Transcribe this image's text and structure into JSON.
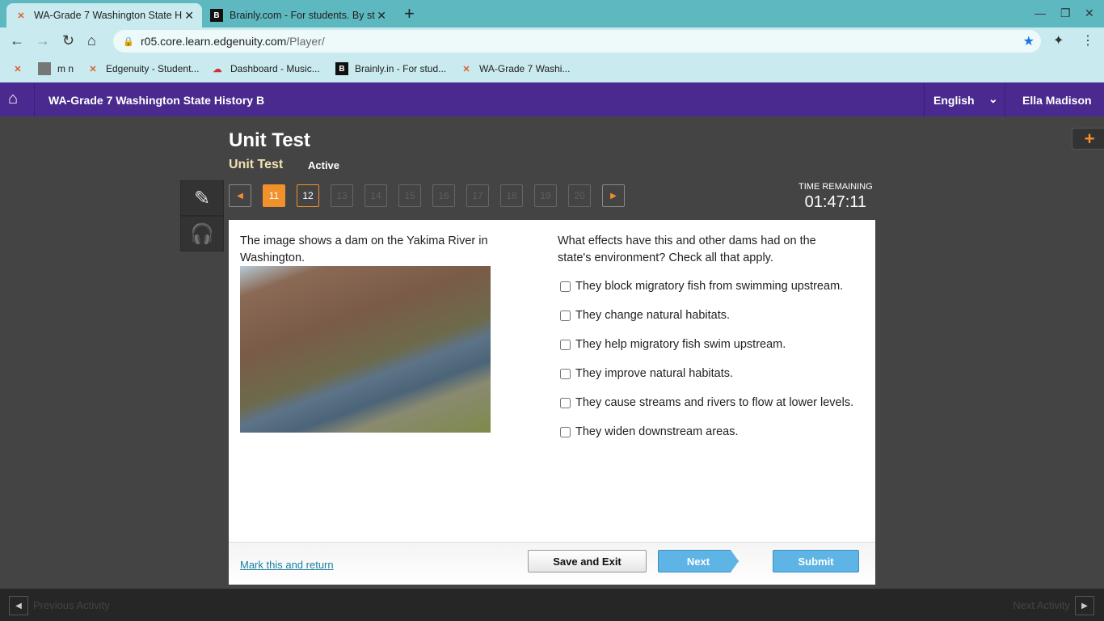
{
  "browser": {
    "tabs": [
      {
        "title": "WA-Grade 7 Washington State H",
        "icon": "edgenuity-icon"
      },
      {
        "title": "Brainly.com - For students. By st",
        "icon": "brainly-icon"
      }
    ],
    "new_tab": "+",
    "url_host": "r05.core.learn.edgenuity.com",
    "url_path": "/Player/",
    "bookmarks": [
      {
        "label": "",
        "icon": "edgenuity-icon"
      },
      {
        "label": "m n",
        "icon": "roblox-icon"
      },
      {
        "label": "Edgenuity - Student...",
        "icon": "edgenuity-icon"
      },
      {
        "label": "Dashboard - Music...",
        "icon": "music-icon"
      },
      {
        "label": "Brainly.in - For stud...",
        "icon": "brainly-icon"
      },
      {
        "label": "WA-Grade 7 Washi...",
        "icon": "edgenuity-icon"
      }
    ]
  },
  "app": {
    "course": "WA-Grade 7 Washington State History B",
    "language": "English",
    "user": "Ella Madison"
  },
  "activity": {
    "title": "Unit Test",
    "subtitle": "Unit Test",
    "status": "Active"
  },
  "pager": {
    "pages": [
      "11",
      "12",
      "13",
      "14",
      "15",
      "16",
      "17",
      "18",
      "19",
      "20"
    ],
    "current": "11"
  },
  "timer": {
    "label": "TIME REMAINING",
    "value": "01:47:11"
  },
  "question": {
    "stimulus": "The image shows a dam on the Yakima River in Washington.",
    "prompt": "What effects have this and other dams had on the state's environment? Check all that apply.",
    "options": [
      "They block migratory fish from swimming upstream.",
      "They change natural habitats.",
      "They help migratory fish swim upstream.",
      "They improve natural habitats.",
      "They cause streams and rivers to flow at lower levels.",
      "They widen downstream areas."
    ]
  },
  "footer": {
    "mark": "Mark this and return",
    "save": "Save and Exit",
    "next": "Next",
    "submit": "Submit"
  },
  "bottom": {
    "prev": "Previous Activity",
    "next": "Next Activity"
  },
  "colors": {
    "accent": "#f0912b",
    "appbar": "#4a2a8e",
    "button": "#5fb4e6"
  }
}
